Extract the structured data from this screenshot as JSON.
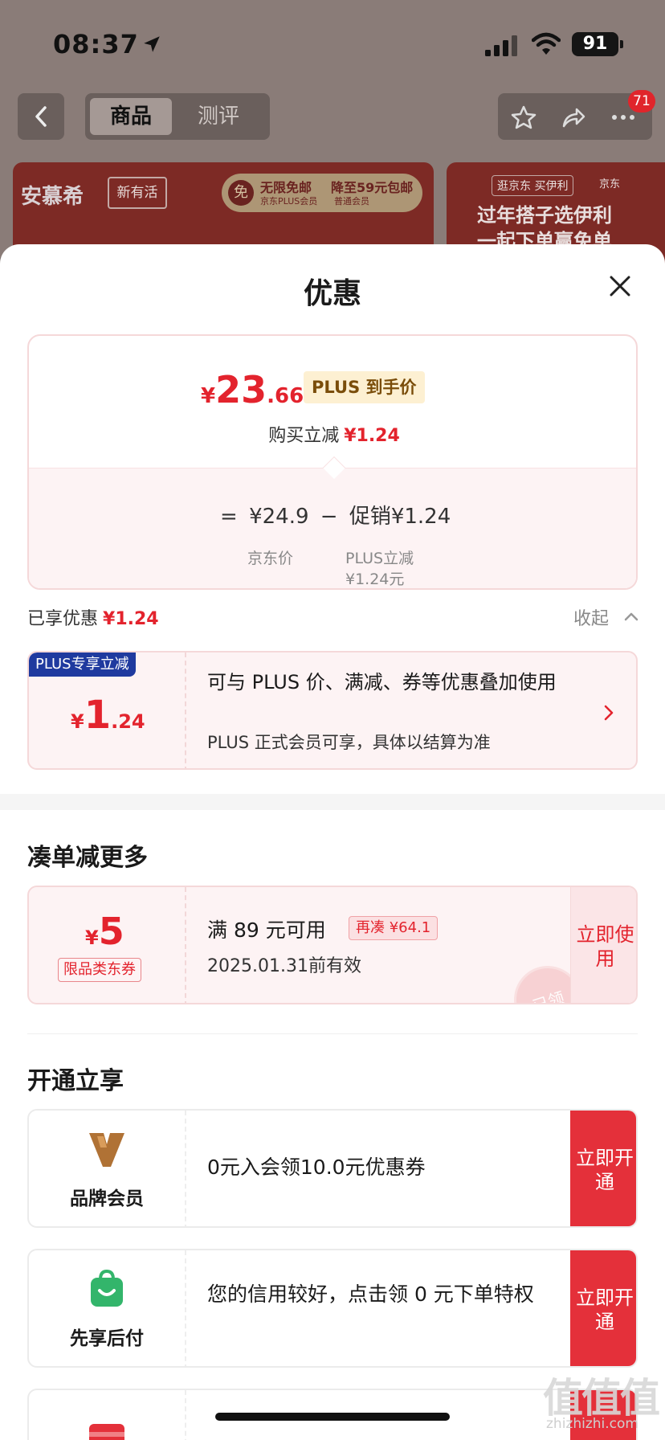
{
  "status_bar": {
    "time": "08:37",
    "battery": "91"
  },
  "nav": {
    "tab_active": "商品",
    "tab_inactive": "测评",
    "badge_count": "71"
  },
  "banners": {
    "b1_logo": "安慕希",
    "b1_logo2": "新有活",
    "b1_pill_icon": "免",
    "b1_pill_a": "无限免邮",
    "b1_pill_b": "京东PLUS会员",
    "b1_pill_c": "降至59元包邮",
    "b1_pill_d": "普通会员",
    "b2_tag": "逛京东 买伊利",
    "b2_brand": "京东",
    "b2_line1": "过年搭子选伊利",
    "b2_line2": "一起下单赢免单"
  },
  "sheet": {
    "title": "优惠"
  },
  "price_card": {
    "currency": "¥",
    "final_int": "23",
    "final_dec": ".66",
    "plus_tag": "PLUS 到手价",
    "reduce_label": "购买立减",
    "reduce_value": "¥1.24",
    "eq": "=",
    "jd_price": "¥24.9",
    "minus": "−",
    "promo": "促销¥1.24",
    "jd_price_label": "京东价",
    "promo_label": "PLUS立减",
    "promo_sub": "¥1.24元"
  },
  "enjoyed": {
    "label": "已享优惠",
    "value": "¥1.24",
    "collapse": "收起"
  },
  "plus_card": {
    "ribbon": "PLUS专享立减",
    "currency": "¥",
    "amount_int": "1",
    "amount_dec": ".24",
    "text1": "可与 PLUS 价、满减、券等优惠叠加使用",
    "text2": "PLUS 正式会员可享，具体以结算为准"
  },
  "section_more": {
    "title": "凑单减更多"
  },
  "coupon": {
    "currency": "¥",
    "amount": "5",
    "type": "限品类东券",
    "condition": "满 89 元可用",
    "more": "再凑 ¥64.1",
    "date": "2025.01.31前有效",
    "stamp": "已领",
    "use_btn": "立即使用"
  },
  "section_open": {
    "title": "开通立享"
  },
  "services": [
    {
      "label": "品牌会员",
      "desc": "0元入会领10.0元优惠券",
      "btn": "立即开通"
    },
    {
      "label": "先享后付",
      "desc": "您的信用较好，点击领 0 元下单特权",
      "btn": "立即开通"
    }
  ],
  "watermark": {
    "main": "值值值",
    "sub": "zhizhizhi.com"
  },
  "colors": {
    "accent_red": "#e3232d",
    "plus_blue": "#1f3a9f",
    "button_red": "#e4303a"
  }
}
